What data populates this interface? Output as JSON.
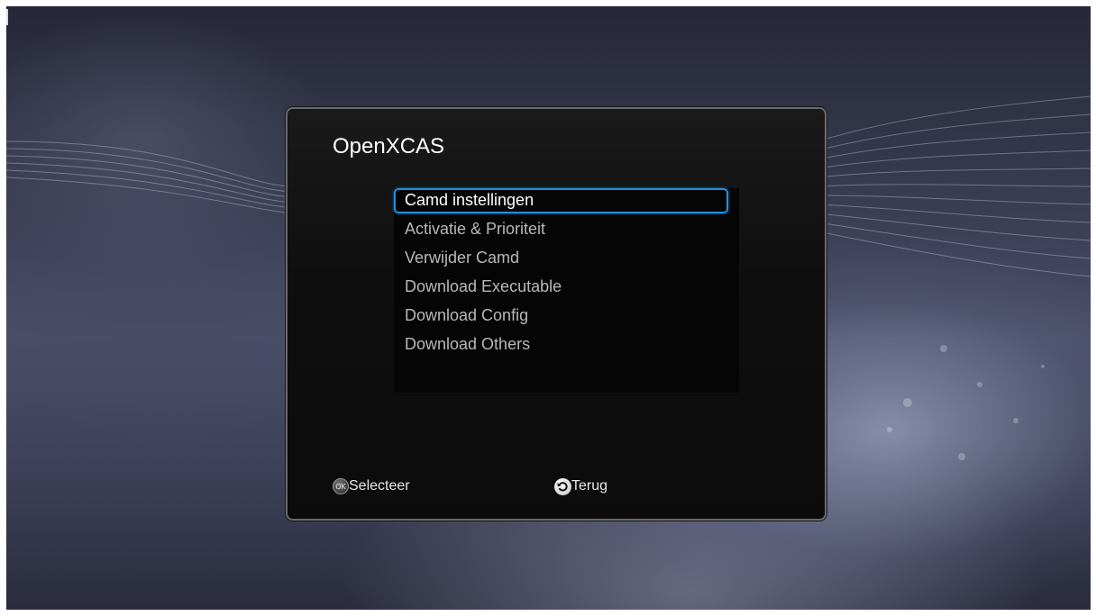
{
  "dialog": {
    "title": "OpenXCAS"
  },
  "menu": {
    "selected_index": 0,
    "items": [
      {
        "label": "Camd instellingen"
      },
      {
        "label": "Activatie & Prioriteit"
      },
      {
        "label": "Verwijder Camd"
      },
      {
        "label": "Download Executable"
      },
      {
        "label": "Download Config"
      },
      {
        "label": "Download Others"
      }
    ]
  },
  "footer": {
    "select": {
      "icon": "ok-button-icon",
      "label": "Selecteer",
      "icon_text": "OK"
    },
    "back": {
      "icon": "back-arrow-icon",
      "label": "Terug"
    }
  },
  "colors": {
    "focus": "#1f8fe0",
    "panel_bg": "#0f0f0f",
    "item_text": "#b8b8b8",
    "selected_text": "#ffffff"
  }
}
